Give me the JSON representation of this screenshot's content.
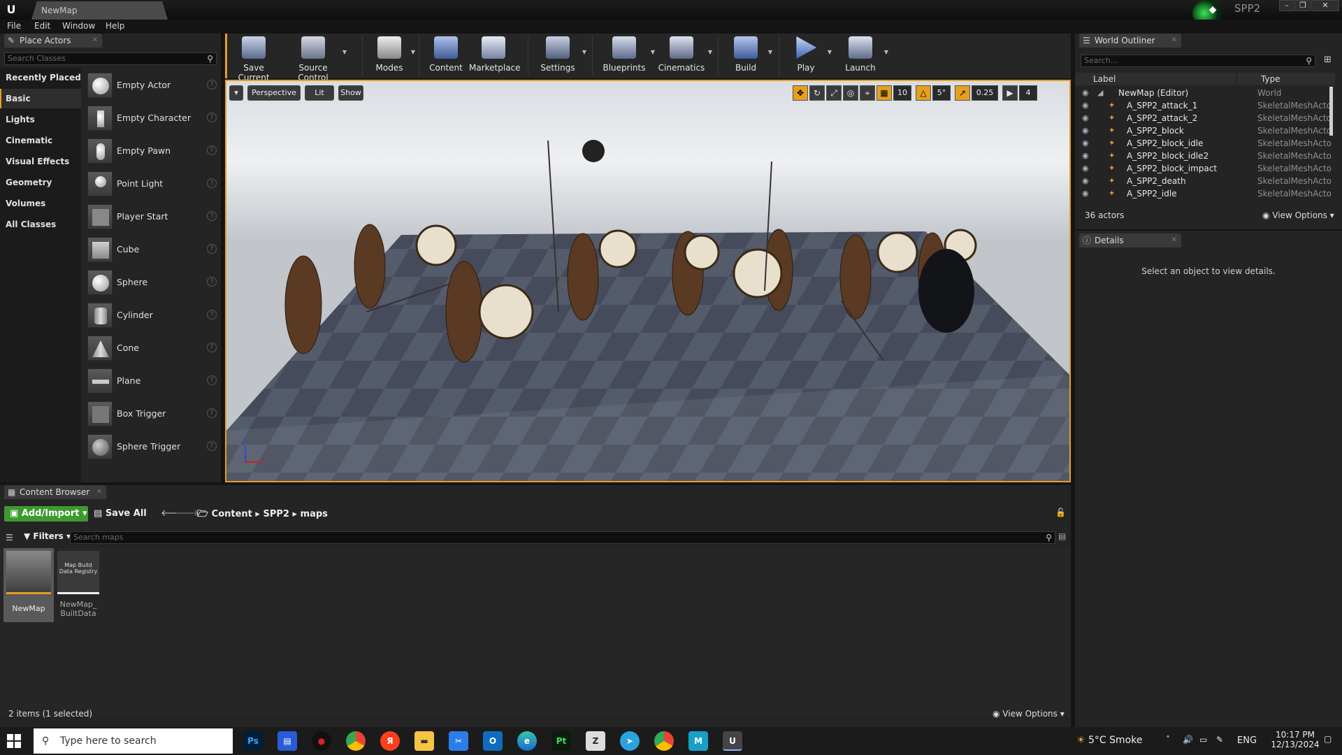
{
  "titlebar": {
    "doc_tab": "NewMap",
    "project": "SPP2",
    "min": "–",
    "max": "❐",
    "close": "✕"
  },
  "menu": [
    "File",
    "Edit",
    "Window",
    "Help"
  ],
  "place_actors": {
    "tab": "Place Actors",
    "search_placeholder": "Search Classes",
    "categories": [
      "Recently Placed",
      "Basic",
      "Lights",
      "Cinematic",
      "Visual Effects",
      "Geometry",
      "Volumes",
      "All Classes"
    ],
    "active_category": "Basic",
    "actors": [
      "Empty Actor",
      "Empty Character",
      "Empty Pawn",
      "Point Light",
      "Player Start",
      "Cube",
      "Sphere",
      "Cylinder",
      "Cone",
      "Plane",
      "Box Trigger",
      "Sphere Trigger"
    ]
  },
  "toolbar": [
    {
      "label": "Save Current",
      "icon": "save-icon",
      "dropdown": false
    },
    {
      "label": "Source Control",
      "icon": "source-control-icon",
      "dropdown": true
    },
    {
      "label": "Modes",
      "icon": "modes-icon",
      "dropdown": true
    },
    {
      "label": "Content",
      "icon": "content-icon",
      "dropdown": false
    },
    {
      "label": "Marketplace",
      "icon": "marketplace-icon",
      "dropdown": false
    },
    {
      "label": "Settings",
      "icon": "settings-icon",
      "dropdown": true
    },
    {
      "label": "Blueprints",
      "icon": "blueprints-icon",
      "dropdown": true
    },
    {
      "label": "Cinematics",
      "icon": "cinematics-icon",
      "dropdown": true
    },
    {
      "label": "Build",
      "icon": "build-icon",
      "dropdown": true
    },
    {
      "label": "Play",
      "icon": "play-icon",
      "dropdown": true
    },
    {
      "label": "Launch",
      "icon": "launch-icon",
      "dropdown": true
    }
  ],
  "viewport": {
    "perspective": "Perspective",
    "lit": "Lit",
    "show": "Show",
    "grid_snap": "10",
    "rot_snap": "5°",
    "scale_snap": "0.25",
    "camera_speed": "4",
    "axis_x": "x",
    "axis_y": "y",
    "axis_z": "z"
  },
  "outliner": {
    "tab": "World Outliner",
    "search_placeholder": "Search...",
    "col_label": "Label",
    "col_type": "Type",
    "rows": [
      {
        "label": "NewMap (Editor)",
        "type": "World"
      },
      {
        "label": "A_SPP2_attack_1",
        "type": "SkeletalMeshActo"
      },
      {
        "label": "A_SPP2_attack_2",
        "type": "SkeletalMeshActo"
      },
      {
        "label": "A_SPP2_block",
        "type": "SkeletalMeshActo"
      },
      {
        "label": "A_SPP2_block_idle",
        "type": "SkeletalMeshActo"
      },
      {
        "label": "A_SPP2_block_idle2",
        "type": "SkeletalMeshActo"
      },
      {
        "label": "A_SPP2_block_impact",
        "type": "SkeletalMeshActo"
      },
      {
        "label": "A_SPP2_death",
        "type": "SkeletalMeshActo"
      },
      {
        "label": "A_SPP2_idle",
        "type": "SkeletalMeshActo"
      }
    ],
    "count": "36 actors",
    "view_options": "View Options"
  },
  "details": {
    "tab": "Details",
    "empty_text": "Select an object to view details."
  },
  "content_browser": {
    "tab": "Content Browser",
    "add_import": "Add/Import",
    "save_all": "Save All",
    "path": [
      "Content",
      "SPP2",
      "maps"
    ],
    "filters": "Filters",
    "search_placeholder": "Search maps",
    "assets": [
      {
        "name": "NewMap",
        "thumb_text": ""
      },
      {
        "name": "NewMap_ BuiltData",
        "thumb_text": "Map Build Data Registry"
      }
    ],
    "status": "2 items (1 selected)",
    "view_options": "View Options"
  },
  "taskbar": {
    "search_placeholder": "Type here to search",
    "weather": "5°C  Smoke",
    "lang": "ENG",
    "time": "10:17 PM",
    "date": "12/13/2024",
    "apps": [
      "Ps",
      "Store",
      "Rec",
      "Chrome",
      "Yandex",
      "Files",
      "Mail",
      "Outlook",
      "Edge",
      "Pt",
      "Zbrush",
      "Telegram",
      "Chrome2",
      "M",
      "UE"
    ]
  },
  "colors": {
    "accent": "#e5a020",
    "add_import": "#3e9a2f",
    "panel": "#242424"
  }
}
